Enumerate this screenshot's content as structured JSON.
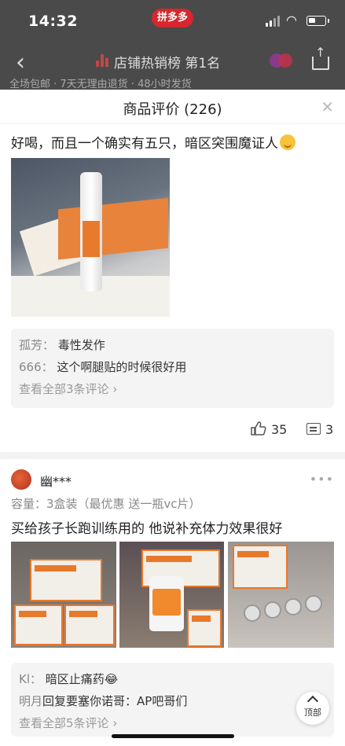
{
  "status_bar": {
    "time": "14:32",
    "brand": "拼多多"
  },
  "nav": {
    "rank_text": "店铺热销榜 第1名"
  },
  "promise_strip": "全场包邮 · 7天无理由退货 · 48小时发货",
  "sheet": {
    "title": "商品评价 (226)"
  },
  "review1": {
    "text": "好喝，而且一个确实有五只，暗区突围魔证人",
    "comments": [
      {
        "user": "孤芳：",
        "text": "毒性发作"
      },
      {
        "user": "666：",
        "text": "这个啊腿贴的时候很好用"
      }
    ],
    "view_all": "查看全部3条评论",
    "likes": "35",
    "comment_count": "3"
  },
  "review2": {
    "username": "幽***",
    "spec": "容量：3盒装（最优惠 送一瓶vc片）",
    "text": "买给孩子长跑训练用的 他说补充体力效果很好",
    "comments": [
      {
        "user": "Kl：",
        "text": "暗区止痛药😂"
      },
      {
        "user": "明月",
        "text": "回复要塞你诺哥：AP吧哥们"
      }
    ],
    "view_all": "查看全部5条评论"
  },
  "scroll_top_label": "顶部"
}
